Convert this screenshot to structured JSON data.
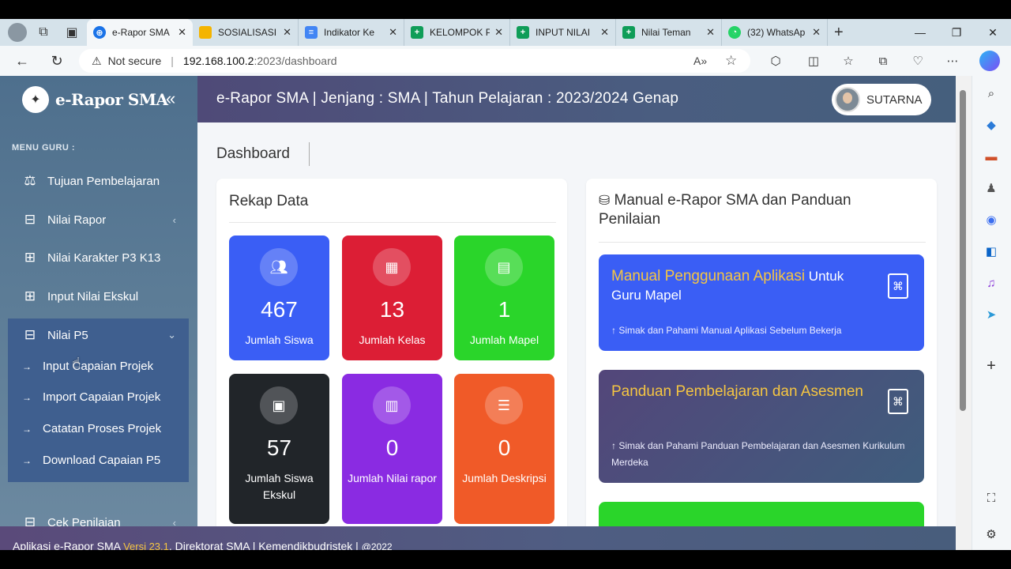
{
  "browser": {
    "tabs": [
      {
        "title": "e-Rapor SMA",
        "favicon_color": "#1a73e8",
        "active": true
      },
      {
        "title": "SOSIALISASI",
        "favicon_color": "#f4b400",
        "active": false
      },
      {
        "title": "Indikator Ke",
        "favicon_color": "#4285f4",
        "active": false
      },
      {
        "title": "KELOMPOK P",
        "favicon_color": "#0f9d58",
        "active": false
      },
      {
        "title": "INPUT NILAI",
        "favicon_color": "#0f9d58",
        "active": false
      },
      {
        "title": "Nilai Teman",
        "favicon_color": "#0f9d58",
        "active": false
      },
      {
        "title": "(32) WhatsAp",
        "favicon_color": "#25d366",
        "active": false
      }
    ],
    "new_tab_label": "+",
    "security_label": "Not secure",
    "url_host": "192.168.100.2",
    "url_path": ":2023/dashboard"
  },
  "app": {
    "brand": "e-Rapor SMA",
    "header_title": "e-Rapor SMA | Jenjang : SMA | Tahun Pelajaran : 2023/2024 Genap",
    "user_name": "SUTARNA",
    "menu_header": "MENU GURU :",
    "menu": [
      {
        "label": "Tujuan Pembelajaran",
        "icon": "scale-icon"
      },
      {
        "label": "Nilai Rapor",
        "icon": "inbox-icon"
      },
      {
        "label": "Nilai Karakter P3 K13",
        "icon": "add-box-icon"
      },
      {
        "label": "Input Nilai Ekskul",
        "icon": "add-box-icon"
      },
      {
        "label": "Nilai P5",
        "icon": "inbox-icon"
      },
      {
        "label": "Cek Penilaian",
        "icon": "inbox-icon"
      }
    ],
    "p5_submenu": [
      "Input Capaian Projek",
      "Import Capaian Projek",
      "Catatan Proses Projek",
      "Download Capaian P5"
    ],
    "breadcrumb": "Dashboard",
    "rekap": {
      "title": "Rekap Data",
      "stats": [
        {
          "value": "467",
          "label": "Jumlah Siswa",
          "color": "#3a5ef5"
        },
        {
          "value": "13",
          "label": "Jumlah Kelas",
          "color": "#dc1e35"
        },
        {
          "value": "1",
          "label": "Jumlah Mapel",
          "color": "#2ad52a"
        },
        {
          "value": "57",
          "label": "Jumlah Siswa Ekskul",
          "color": "#212529"
        },
        {
          "value": "0",
          "label": "Jumlah Nilai rapor",
          "color": "#8a2be2"
        },
        {
          "value": "0",
          "label": "Jumlah Deskripsi",
          "color": "#f05a28"
        }
      ]
    },
    "manual": {
      "title": "Manual e-Rapor SMA dan Panduan Penilaian",
      "guides": [
        {
          "title_hl": "Manual Penggunaan Aplikasi",
          "title_rest": " Untuk Guru Mapel",
          "subtitle": "↑ Simak dan Pahami Manual Aplikasi Sebelum Bekerja",
          "color": "#3a5ef5"
        },
        {
          "title_hl": "Panduan Pembelajaran dan Asesmen",
          "title_rest": "",
          "subtitle": "↑ Simak dan Pahami Panduan Pembelajaran dan Asesmen Kurikulum Merdeka",
          "color": "#4a4a7a"
        }
      ]
    },
    "footer": {
      "app": "Aplikasi e-Rapor SMA ",
      "version": "Versi 23.1",
      "org": ", Direktorat SMA | Kemendikbudristek | ",
      "year": "@2022"
    }
  }
}
